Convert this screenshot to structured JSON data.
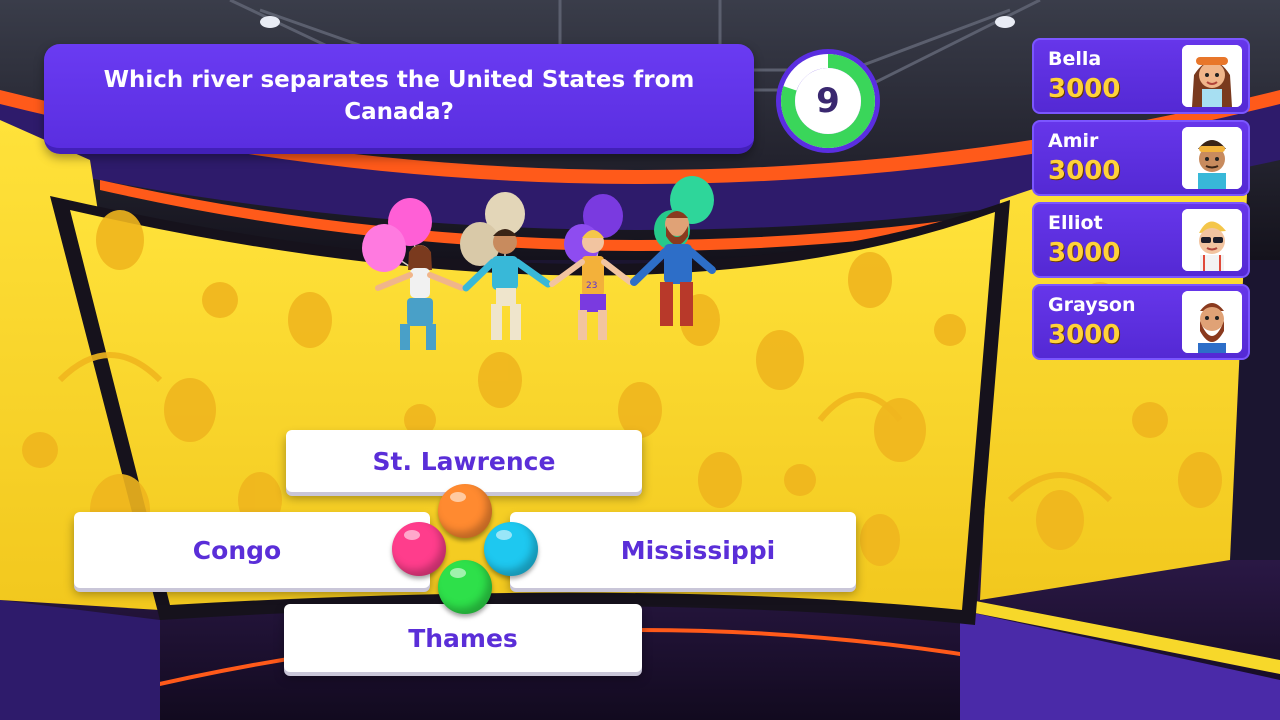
{
  "question": {
    "text": "Which river separates the United States from Canada?"
  },
  "timer": {
    "seconds_left": "9",
    "ring_fraction": 0.8,
    "ring_color": "#3ad65a",
    "ring_bg": "#ffffff"
  },
  "players": [
    {
      "name": "Bella",
      "score": "3000",
      "avatar": "woman-with-goggles-avatar"
    },
    {
      "name": "Amir",
      "score": "3000",
      "avatar": "man-with-sunglasses-on-head-avatar"
    },
    {
      "name": "Elliot",
      "score": "3000",
      "avatar": "blond-man-with-sunglasses-avatar"
    },
    {
      "name": "Grayson",
      "score": "3000",
      "avatar": "bearded-man-avatar"
    }
  ],
  "answers": {
    "top": "St. Lawrence",
    "left": "Congo",
    "right": "Mississippi",
    "bottom": "Thames"
  },
  "colors": {
    "accent_purple": "#5a2ee0",
    "score_yellow": "#ffd23a",
    "screen_yellow": "#f7d82a",
    "answer_orange": "#ff8a30",
    "answer_pink": "#ff3d8c",
    "answer_cyan": "#1ec8f0",
    "answer_green": "#2ee04a"
  }
}
